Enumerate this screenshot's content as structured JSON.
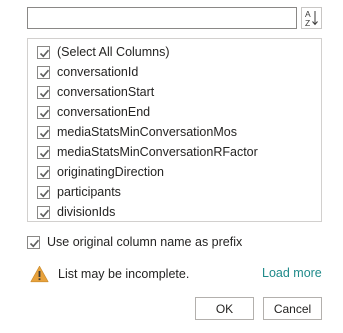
{
  "search": {
    "value": "",
    "placeholder": ""
  },
  "sort_button": {
    "icon": "sort-az-icon",
    "glyph_top": "A",
    "glyph_bottom": "Z"
  },
  "columns": {
    "items": [
      {
        "label": "(Select All Columns)",
        "checked": true
      },
      {
        "label": "conversationId",
        "checked": true
      },
      {
        "label": "conversationStart",
        "checked": true
      },
      {
        "label": "conversationEnd",
        "checked": true
      },
      {
        "label": "mediaStatsMinConversationMos",
        "checked": true
      },
      {
        "label": "mediaStatsMinConversationRFactor",
        "checked": true
      },
      {
        "label": "originatingDirection",
        "checked": true
      },
      {
        "label": "participants",
        "checked": true
      },
      {
        "label": "divisionIds",
        "checked": true
      }
    ]
  },
  "prefix_option": {
    "label": "Use original column name as prefix",
    "checked": true
  },
  "warning": {
    "icon": "warning-icon",
    "text": "List may be incomplete."
  },
  "load_more": {
    "label": "Load more"
  },
  "buttons": {
    "ok": "OK",
    "cancel": "Cancel"
  },
  "colors": {
    "link": "#1f8a8a",
    "checkmark": "#5f5f5f",
    "warning_fill": "#e8a23c",
    "border": "#8a8886"
  }
}
